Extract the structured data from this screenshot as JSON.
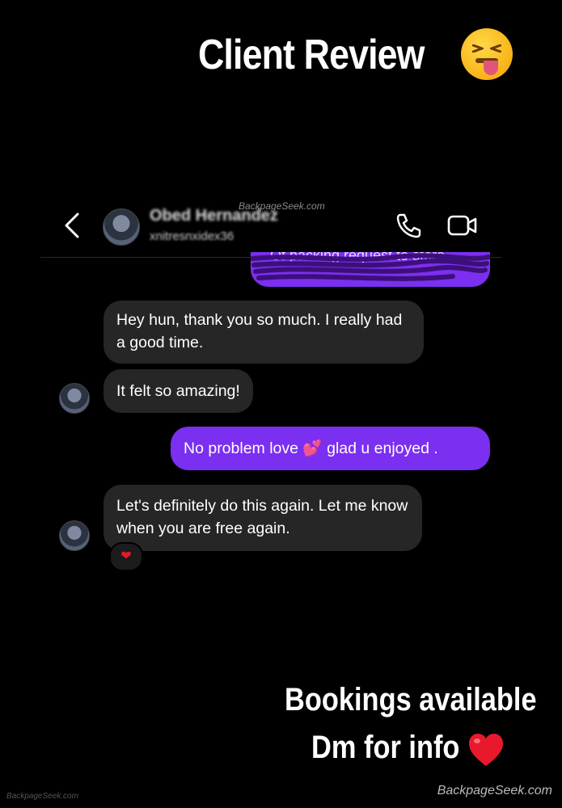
{
  "story": {
    "title": "Client Review",
    "title_emoji": "squinting-face-with-tongue",
    "footer_line1": "Bookings available",
    "footer_line2": "Dm for info",
    "footer_emoji": "❤️"
  },
  "chat_header": {
    "contact_name": "Obed Hernandez",
    "contact_username": "xnitresnxidex36",
    "icons": [
      "back-arrow-icon",
      "phone-icon",
      "video-call-icon"
    ]
  },
  "messages": [
    {
      "direction": "out",
      "text": "Of packing request to store",
      "redacted": true
    },
    {
      "direction": "in",
      "text": "Hey hun, thank you so much. I really had a good time."
    },
    {
      "direction": "in",
      "text": "It felt so amazing!"
    },
    {
      "direction": "out",
      "text_before": "No problem love",
      "emoji": "💕",
      "text_after": "glad u enjoyed ."
    },
    {
      "direction": "in",
      "text": "Let's definitely do this again. Let me know when you are free again.",
      "reaction": "❤"
    }
  ],
  "watermarks": {
    "top": "BackpageSeek.com",
    "bottom_right": "BackpageSeek.com",
    "bottom_left": "BackpageSeek.com"
  },
  "colors": {
    "background": "#000000",
    "incoming_bubble": "#262626",
    "outgoing_bubble": "#7b2ff0",
    "heart": "#e8192c"
  }
}
